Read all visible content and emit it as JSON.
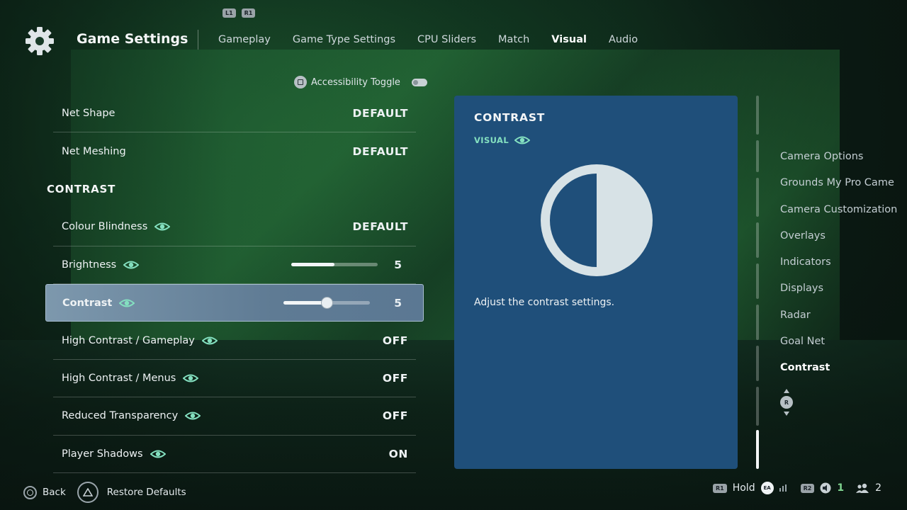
{
  "header": {
    "bumper_left": "L1",
    "bumper_right": "R1",
    "title": "Game Settings",
    "tabs": [
      "Gameplay",
      "Game Type Settings",
      "CPU Sliders",
      "Match",
      "Visual",
      "Audio"
    ],
    "active_tab": "Visual"
  },
  "accessibility_toggle": {
    "label": "Accessibility Toggle",
    "enabled": false
  },
  "settings": {
    "net_shape": {
      "label": "Net Shape",
      "value": "DEFAULT"
    },
    "net_meshing": {
      "label": "Net Meshing",
      "value": "DEFAULT"
    },
    "section_title": "CONTRAST",
    "colour_blindness": {
      "label": "Colour Blindness",
      "value": "DEFAULT"
    },
    "brightness": {
      "label": "Brightness",
      "value": "5",
      "level": 0.5
    },
    "contrast": {
      "label": "Contrast",
      "value": "5",
      "level": 0.5
    },
    "high_contrast_gameplay": {
      "label": "High Contrast / Gameplay",
      "value": "OFF"
    },
    "high_contrast_menus": {
      "label": "High Contrast / Menus",
      "value": "OFF"
    },
    "reduced_transparency": {
      "label": "Reduced Transparency",
      "value": "OFF"
    },
    "player_shadows": {
      "label": "Player Shadows",
      "value": "ON"
    }
  },
  "info_panel": {
    "title": "CONTRAST",
    "tag": "VISUAL",
    "description": "Adjust the contrast settings.",
    "icon": "contrast-half-circle-icon"
  },
  "right_nav": {
    "items": [
      "Camera Options",
      "Grounds My Pro Came",
      "Camera Customization",
      "Overlays",
      "Indicators",
      "Displays",
      "Radar",
      "Goal Net",
      "Contrast"
    ],
    "active": "Contrast",
    "stick_label": "R"
  },
  "footer": {
    "back": "Back",
    "restore_defaults": "Restore Defaults",
    "hold_button": "R1",
    "hold": "Hold",
    "ea_label": "EA",
    "r2_button": "R2",
    "voice_count": "1",
    "players_count": "2"
  },
  "colors": {
    "panel": "#1f4f7a",
    "accent_teal": "#84e0c0",
    "selected_row": "#6f8ba2"
  }
}
